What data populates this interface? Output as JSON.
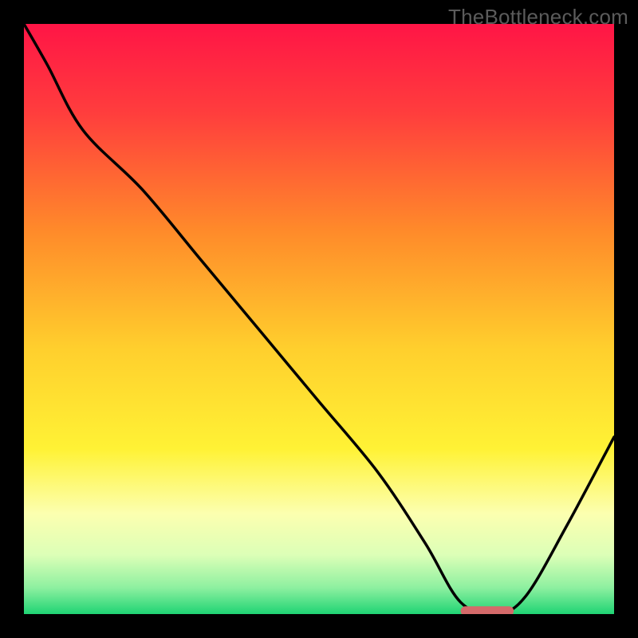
{
  "watermark": "TheBottleneck.com",
  "chart_data": {
    "type": "line",
    "x": [
      0.0,
      0.04,
      0.1,
      0.2,
      0.3,
      0.4,
      0.5,
      0.6,
      0.68,
      0.74,
      0.8,
      0.85,
      0.92,
      1.0
    ],
    "values": [
      1.0,
      0.93,
      0.82,
      0.72,
      0.6,
      0.48,
      0.36,
      0.24,
      0.12,
      0.02,
      0.0,
      0.03,
      0.15,
      0.3
    ],
    "title": "",
    "xlabel": "",
    "ylabel": "",
    "xlim": [
      0,
      1
    ],
    "ylim": [
      0,
      1
    ],
    "marker": {
      "x_start": 0.74,
      "x_end": 0.83,
      "y": 0.005,
      "color": "#d46a6a"
    },
    "background": {
      "type": "vertical-gradient",
      "stops": [
        {
          "at": 0.0,
          "color": "#ff1546"
        },
        {
          "at": 0.15,
          "color": "#ff3d3d"
        },
        {
          "at": 0.35,
          "color": "#ff8a2a"
        },
        {
          "at": 0.55,
          "color": "#ffcf2d"
        },
        {
          "at": 0.72,
          "color": "#fff235"
        },
        {
          "at": 0.83,
          "color": "#fcffb0"
        },
        {
          "at": 0.9,
          "color": "#dcffb7"
        },
        {
          "at": 0.955,
          "color": "#8ef0a0"
        },
        {
          "at": 1.0,
          "color": "#1fd474"
        }
      ]
    }
  }
}
